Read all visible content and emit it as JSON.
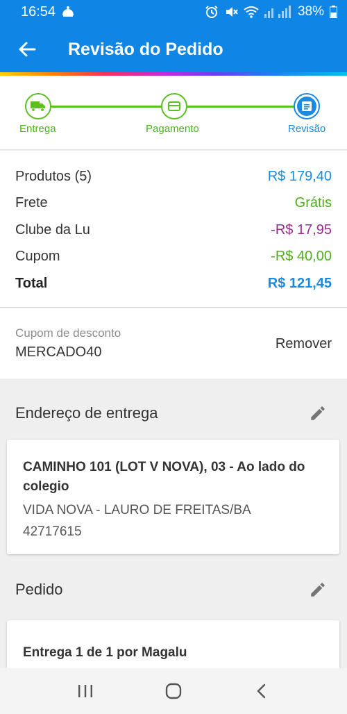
{
  "status_bar": {
    "time": "16:54",
    "battery": "38%"
  },
  "header": {
    "title": "Revisão do Pedido"
  },
  "stepper": {
    "steps": [
      {
        "label": "Entrega",
        "icon": "truck-icon"
      },
      {
        "label": "Pagamento",
        "icon": "card-icon"
      },
      {
        "label": "Revisão",
        "icon": "list-icon"
      }
    ],
    "done_color": "#5bbf21",
    "active_color": "#1b8be0"
  },
  "summary": {
    "rows": [
      {
        "label": "Produtos (5)",
        "value": "R$ 179,40",
        "color": "#1b8be0"
      },
      {
        "label": "Frete",
        "value": "Grátis",
        "color": "#4fae1c"
      },
      {
        "label": "Clube da Lu",
        "value": "-R$ 17,95",
        "color": "#9b2a8c"
      },
      {
        "label": "Cupom",
        "value": "-R$ 40,00",
        "color": "#4fae1c"
      }
    ],
    "total": {
      "label": "Total",
      "value": "R$ 121,45",
      "color": "#1b8be0"
    }
  },
  "coupon": {
    "caption": "Cupom de desconto",
    "code": "MERCADO40",
    "remove_label": "Remover"
  },
  "address_section": {
    "title": "Endereço de entrega",
    "street": "CAMINHO 101 (LOT V NOVA), 03 - Ao lado do colegio",
    "city": "VIDA NOVA - LAURO DE FREITAS/BA",
    "zip": "42717615"
  },
  "order_section": {
    "title": "Pedido",
    "delivery": "Entrega 1 de 1 por Magalu"
  },
  "colors": {
    "brand_blue": "#0f86e6",
    "text_gray": "#333333"
  }
}
